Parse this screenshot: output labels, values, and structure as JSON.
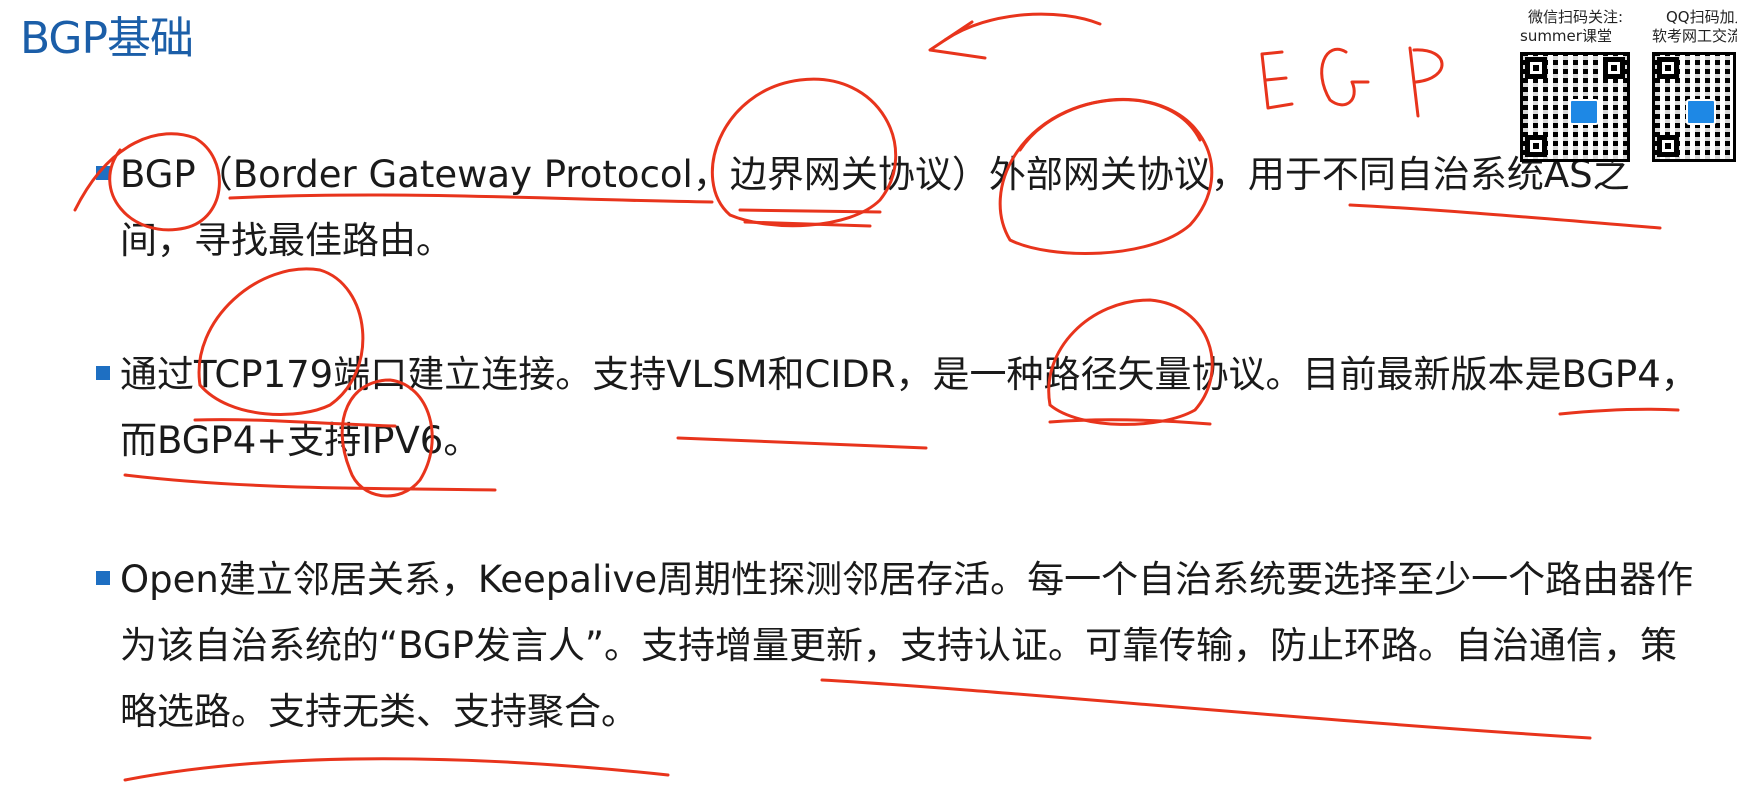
{
  "slide": {
    "title": "BGP基础"
  },
  "bullets": [
    "BGP（Border Gateway Protocol，边界网关协议）外部网关协议，用于不同自治系统AS之间，寻找最佳路由。",
    "通过TCP179端口建立连接。支持VLSM和CIDR，是一种路径矢量协议。目前最新版本是BGP4，而BGP4+支持IPV6。",
    "Open建立邻居关系，Keepalive周期性探测邻居存活。每一个自治系统要选择至少一个路由器作为该自治系统的“BGP发言人”。支持增量更新，支持认证。可靠传输，防止环路。自治通信，策略选路。支持无类、支持聚合。"
  ],
  "qr_codes": [
    {
      "line1": "微信扫码关注:",
      "line2": "summer课堂"
    },
    {
      "line1": "QQ扫码加入",
      "line2": "软考网工交流"
    }
  ],
  "annotations": {
    "handwritten_note": "EGP",
    "ink_color": "#e8341c"
  }
}
